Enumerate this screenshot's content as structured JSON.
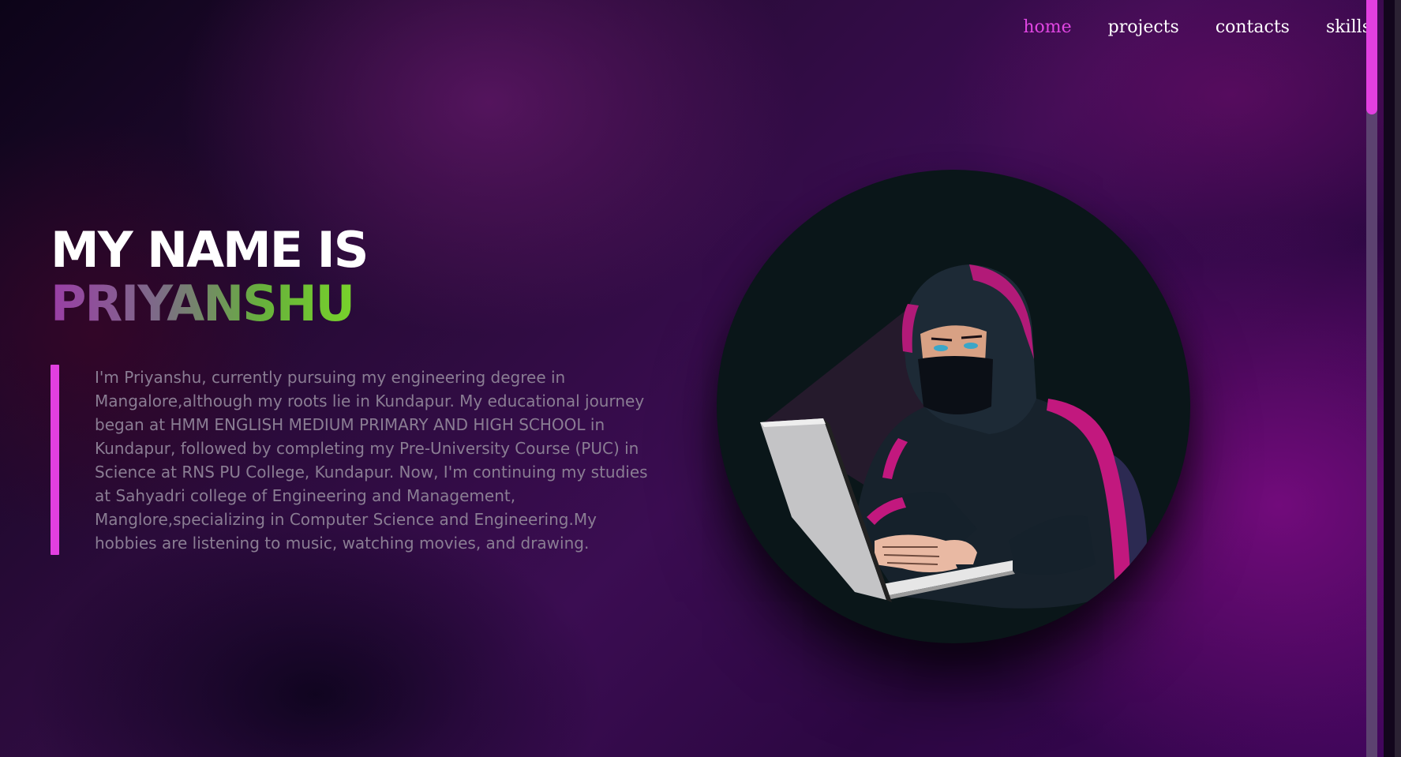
{
  "nav": {
    "items": [
      {
        "label": "home",
        "active": true
      },
      {
        "label": "projects",
        "active": false
      },
      {
        "label": "contacts",
        "active": false
      },
      {
        "label": "skills",
        "active": false
      }
    ]
  },
  "hero": {
    "line1": "MY NAME IS",
    "name": "PRIYANSHU"
  },
  "bio": {
    "text": "I'm Priyanshu, currently pursuing my engineering degree in Mangalore,although my roots lie in Kundapur. My educational journey began at HMM ENGLISH MEDIUM PRIMARY AND HIGH SCHOOL in Kundapur, followed by completing my Pre-University Course (PUC) in Science at RNS PU College, Kundapur. Now, I'm continuing my studies at Sahyadri college of Engineering and Management, Manglore,specializing in Computer Science and Engineering.My hobbies are listening to music, watching movies, and drawing."
  },
  "avatar": {
    "icon": "hooded-hacker-laptop-illustration"
  },
  "colors": {
    "accent": "#e23fe0",
    "nav_active": "#e146e3",
    "bio_text": "#8a7d93"
  }
}
